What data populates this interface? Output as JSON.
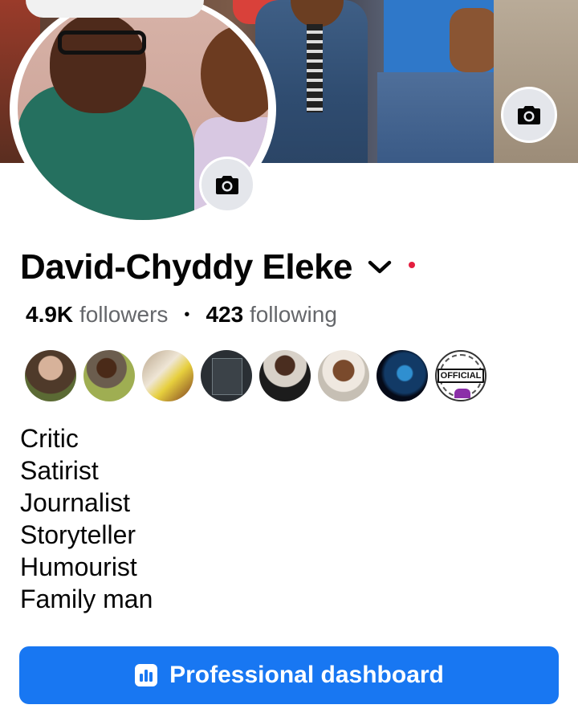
{
  "profile": {
    "name": "David-Chyddy Eleke",
    "followers_count": "4.9K",
    "followers_label": "followers",
    "following_count": "423",
    "following_label": "following",
    "separator": "•"
  },
  "featured_badge": "OFFICIAL",
  "bio": {
    "lines": [
      "Critic",
      "Satirist",
      "Journalist",
      "Storyteller",
      "Humourist",
      "Family man"
    ]
  },
  "actions": {
    "dashboard_label": "Professional dashboard"
  },
  "colors": {
    "primary": "#1877f2",
    "notification_dot": "#e41e3f",
    "secondary_text": "#65676b"
  },
  "icons": {
    "cover_camera": "camera-icon",
    "avatar_camera": "camera-icon",
    "name_dropdown": "chevron-down-icon",
    "dashboard": "bar-chart-icon"
  }
}
